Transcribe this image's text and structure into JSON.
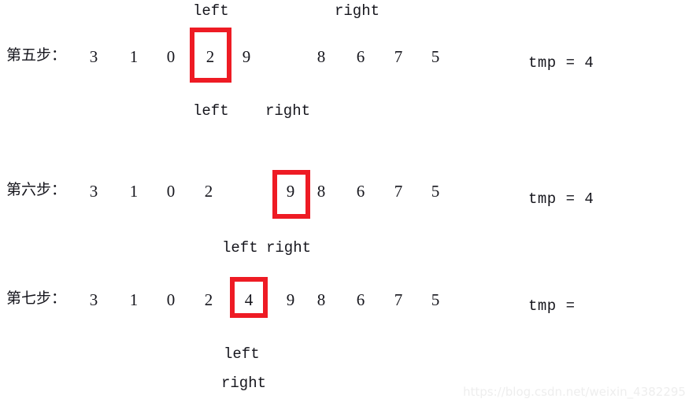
{
  "figure": {
    "title": "Sorting algorithm step trace",
    "accent_color": "#ee1b24",
    "text_color": "#16161d",
    "background": "#ffffff"
  },
  "rows": [
    {
      "step_label": "第五步：",
      "values": [
        "3",
        "1",
        "0",
        "2",
        "9",
        "8",
        "6",
        "7",
        "5"
      ],
      "tmp": "tmp = 4",
      "pointers": [
        {
          "label": "left"
        },
        {
          "label": "right"
        }
      ]
    },
    {
      "step_label": "第六步：",
      "values": [
        "3",
        "1",
        "0",
        "2",
        "9",
        "8",
        "6",
        "7",
        "5"
      ],
      "tmp": "tmp = 4",
      "pointers": [
        {
          "label": "left"
        },
        {
          "label": "right"
        }
      ]
    },
    {
      "step_label": "第七步：",
      "values": [
        "3",
        "1",
        "0",
        "2",
        "4",
        "9",
        "8",
        "6",
        "7",
        "5"
      ],
      "tmp": "tmp =",
      "pointers": [
        {
          "label": "left"
        },
        {
          "label": "right"
        },
        {
          "label": "left"
        },
        {
          "label": "right"
        }
      ]
    }
  ],
  "watermark": {
    "text": "https://blog.csdn.net/weixin_43822955"
  }
}
